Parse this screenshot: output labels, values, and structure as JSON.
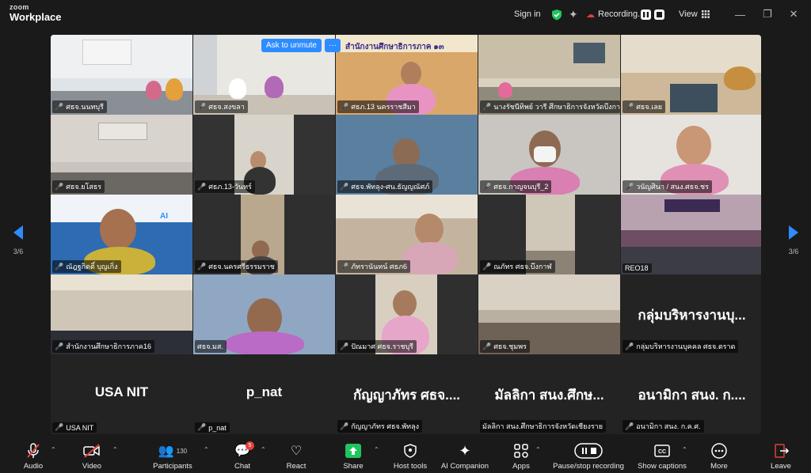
{
  "app": {
    "brand_top": "zoom",
    "brand_bottom": "Workplace"
  },
  "topbar": {
    "sign_in": "Sign in",
    "recording": "Recording...",
    "view": "View"
  },
  "unmute": {
    "button": "Ask to unmute"
  },
  "pagination": {
    "left": "3/6",
    "right": "3/6"
  },
  "participants": [
    "ศธจ.นนทบุรี",
    "ศธจ.สงขลา",
    "ศธภ.13 นครราชสีมา",
    "นางรัชนีทิพย์ วารี ศึกษาธิการจังหวัดบึงกา...",
    "ศธจ.เลย",
    "ศธจ.ยโสธร",
    "ศธภ.13-วันทร์",
    "ศธจ.พัทลุง-ศน.ธัญญณัศภ์",
    "ศธจ.กาญจนบุรี_2",
    "วนัญศินา / สนง.ศธจ.ชร",
    "ณัฎฐกิตติ์ บุญเกิ่ง",
    "ศธจ.นครศรีธรรมราช",
    "ภัทรานันทน์ ศธภ6",
    "ณภัทร ศธจ.บึงกาฬ",
    "REO18",
    "สำนักงานศึกษาธิการภาค16",
    "ศธจ.มส.",
    "ปัณมาศ ศธจ.ราชบุรี",
    "ศธจ.ชุมพร",
    "กลุ่มบริหารงานบุคคล ศธจ.ตราด",
    "USA NIT",
    "p_nat",
    "กัญญาภัทร ศธจ.พัทลุง",
    "มัลลิกา สนง.ศึกษาธิการจังหวัดเชียงราย",
    "อนามิกา สนง. ก.ค.ศ."
  ],
  "big_names": {
    "t19": "กลุ่มบริหารงานบุ...",
    "t20": "USA NIT",
    "t21": "p_nat",
    "t22": "กัญญาภัทร ศธจ....",
    "t23": "มัลลิกา สนง.ศึกษ...",
    "t24": "อนามิกา สนง. ก...."
  },
  "tile_texts": {
    "banner_title": "สำนักงานศึกษาธิการภาค ๑๓",
    "ai_text": "AI"
  },
  "toolbar": {
    "audio": "Audio",
    "video": "Video",
    "participants": "Participants",
    "participants_count": "130",
    "chat": "Chat",
    "chat_badge": "5",
    "react": "React",
    "share": "Share",
    "host_tools": "Host tools",
    "ai_companion": "AI Companion",
    "apps": "Apps",
    "pause_stop": "Pause/stop recording",
    "captions": "Show captions",
    "more": "More",
    "leave": "Leave"
  },
  "colors": {
    "accent": "#2d8cff",
    "muted_red": "#e0413b",
    "share_green": "#21c45d"
  }
}
